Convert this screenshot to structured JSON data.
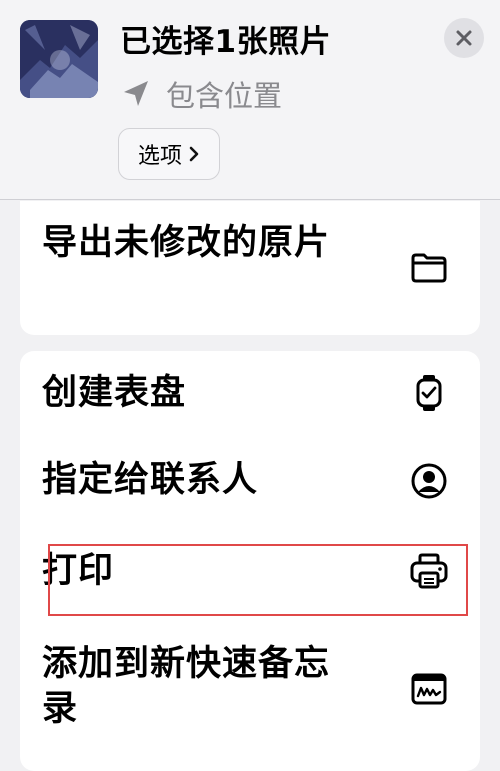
{
  "header": {
    "title": "已选择1张照片",
    "subtitle": "包含位置",
    "options_label": "选项",
    "thumbnail_icon": "photo-thumbnail",
    "location_icon": "location-arrow-icon",
    "close_icon": "close-icon",
    "chevron_icon": "chevron-right-icon"
  },
  "actions_group1": [
    {
      "label": "导出未修改的原片",
      "icon": "folder-icon"
    }
  ],
  "actions_group2": [
    {
      "label": "创建表盘",
      "icon": "watch-icon"
    },
    {
      "label": "指定给联系人",
      "icon": "contact-icon"
    },
    {
      "label": "打印",
      "icon": "printer-icon"
    },
    {
      "label": "添加到新快速备忘录",
      "icon": "quick-note-icon"
    }
  ],
  "colors": {
    "highlight": "#e04848",
    "background": "#f1f1f3",
    "card": "#ffffff",
    "secondary_text": "#8a8a8e"
  }
}
